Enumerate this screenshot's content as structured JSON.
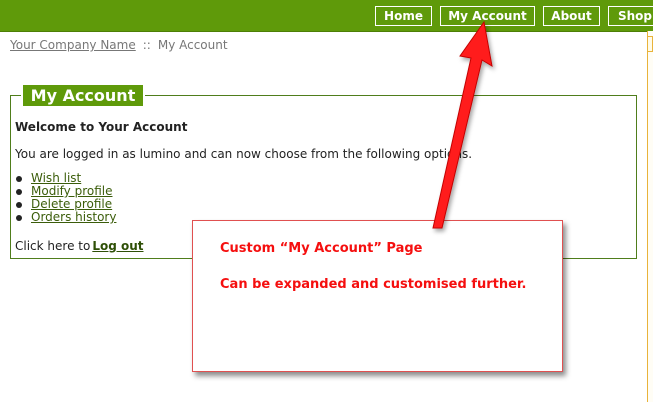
{
  "nav": {
    "items": [
      {
        "label": "Home"
      },
      {
        "label": "My Account"
      },
      {
        "label": "About"
      },
      {
        "label": "Shopp"
      }
    ]
  },
  "breadcrumb": {
    "company": "Your Company Name",
    "separator": "::",
    "current": "My Account"
  },
  "account": {
    "title": "My Account",
    "welcome": "Welcome to Your Account",
    "intro": "You are logged in as lumino and can now choose from the following options.",
    "options": [
      "Wish list",
      "Modify profile",
      "Delete profile",
      "Orders history"
    ],
    "logout_prefix": "Click here to",
    "logout_label": "Log out"
  },
  "annotation": {
    "line1": "Custom “My Account” Page",
    "line2": "Can be expanded and customised further."
  },
  "colors": {
    "nav_bg": "#5f9a0a",
    "panel_border": "#4f7d1b",
    "annotation_red": "#f50f0f"
  }
}
